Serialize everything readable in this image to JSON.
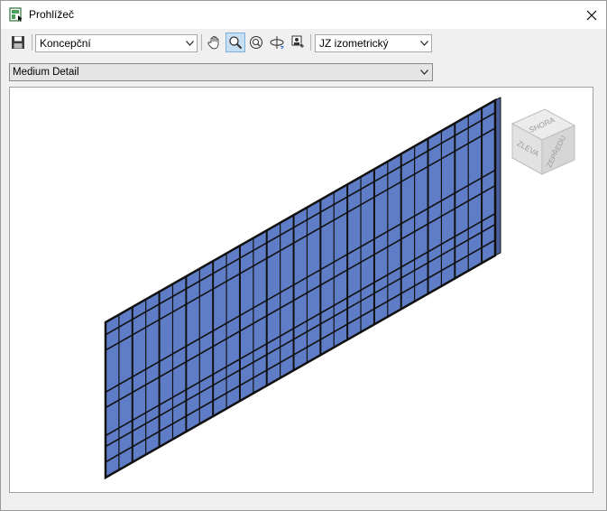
{
  "window": {
    "title": "Prohlížeč"
  },
  "toolbar": {
    "visual_style": "Koncepční",
    "view_orientation": "JZ izometrický",
    "tools": [
      "save-icon",
      "pan-icon",
      "zoom-icon",
      "zoom-fit-icon",
      "orbit-icon",
      "camera-icon"
    ]
  },
  "detail_level": {
    "value": "Medium Detail"
  },
  "viewcube": {
    "top": "SHORA",
    "left": "ZLEVA",
    "front": "ZEPŘEDU"
  },
  "colors": {
    "panel_fill": "#5f7dc6",
    "frame": "#111111",
    "accent": "#c7dff5"
  }
}
